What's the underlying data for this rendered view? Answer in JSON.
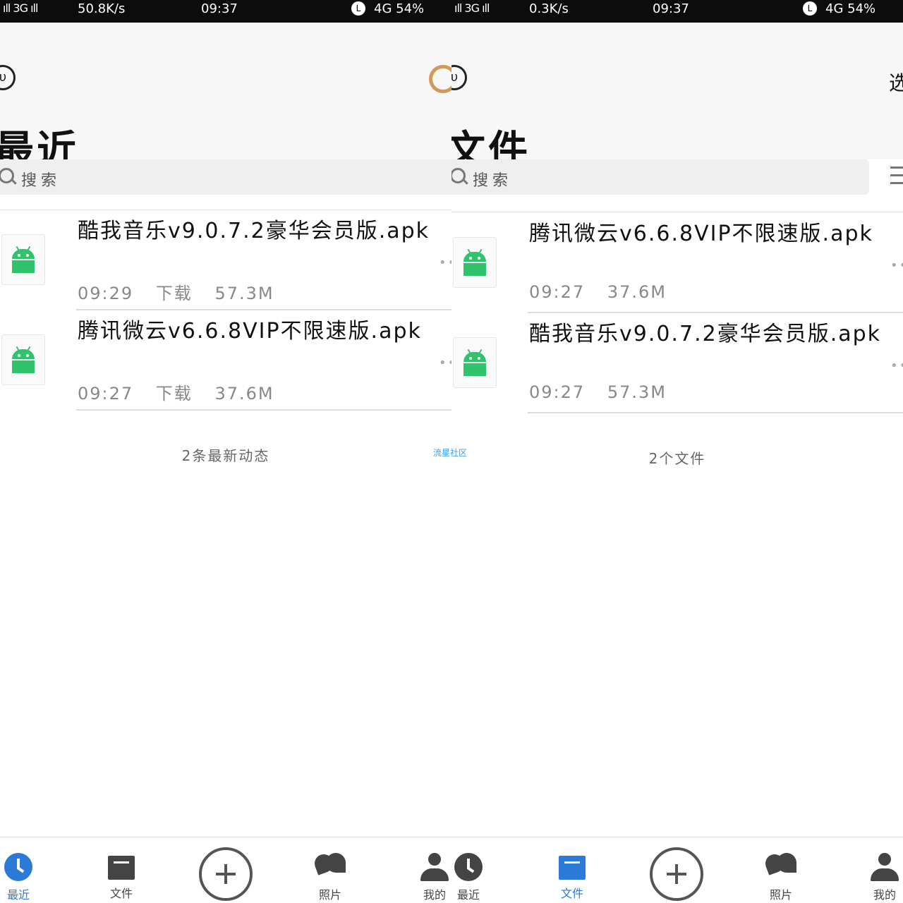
{
  "watermark": "流星社区",
  "left": {
    "status": {
      "signal": "ıll 3G ıll",
      "speed": "50.8K/s",
      "time": "09:37",
      "alarm": "L",
      "battery": "4G 54%"
    },
    "title": "最近",
    "search_placeholder": "搜索",
    "files": [
      {
        "name": "酷我音乐v9.0.7.2豪华会员版.apk",
        "time": "09:29",
        "action": "下载",
        "size": "57.3M"
      },
      {
        "name": "腾讯微云v6.6.8VIP不限速版.apk",
        "time": "09:27",
        "action": "下载",
        "size": "37.6M"
      }
    ],
    "summary": "2条最新动态",
    "tabs": [
      "最近",
      "文件",
      "照片",
      "我的"
    ]
  },
  "right": {
    "status": {
      "signal": "ıll 3G ıll",
      "speed": "0.3K/s",
      "time": "09:37",
      "alarm": "L",
      "battery": "4G 54%"
    },
    "title": "文件",
    "select": "选",
    "search_placeholder": "搜索",
    "files": [
      {
        "name": "腾讯微云v6.6.8VIP不限速版.apk",
        "time": "09:27",
        "size": "37.6M"
      },
      {
        "name": "酷我音乐v9.0.7.2豪华会员版.apk",
        "time": "09:27",
        "size": "57.3M"
      }
    ],
    "summary": "2个文件",
    "tabs": [
      "最近",
      "文件",
      "照片",
      "我的"
    ]
  },
  "colors": {
    "accent": "#2b7ad8",
    "android_green": "#2fc46c",
    "brand_orange": "#d09a5a"
  },
  "icons": [
    "clock-icon",
    "folder-icon",
    "add-icon",
    "photo-icon",
    "user-icon",
    "android-icon",
    "search-icon",
    "more-icon",
    "cloud-icon"
  ]
}
